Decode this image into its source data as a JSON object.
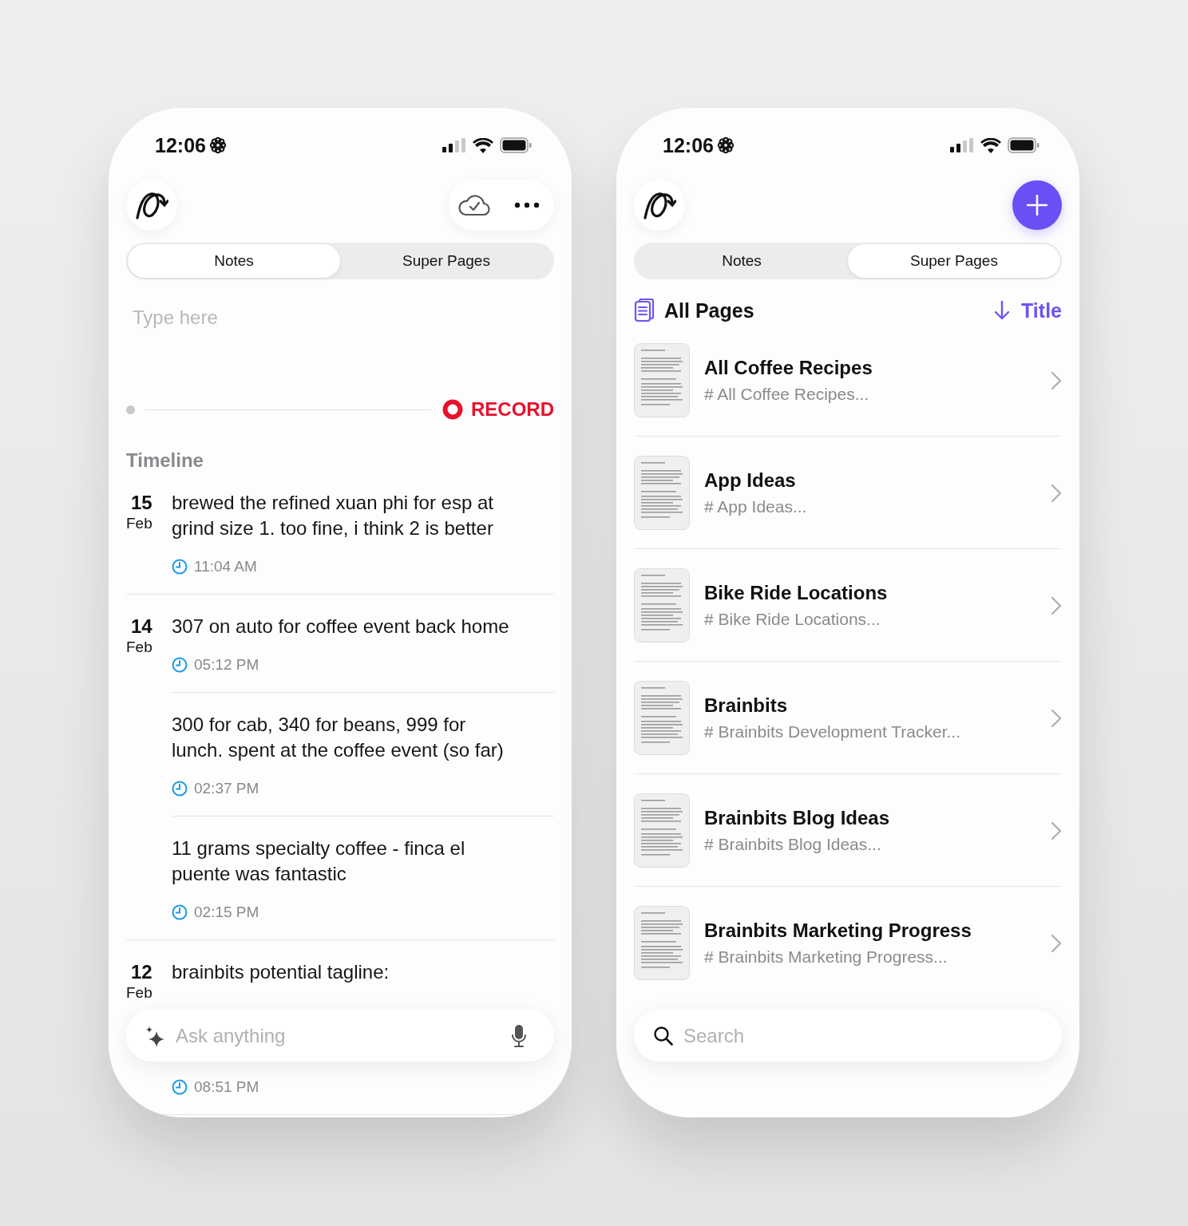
{
  "notes_screen": {
    "status_bar": {
      "time": "12:06"
    },
    "tabs": [
      {
        "label": "Notes",
        "selected": true
      },
      {
        "label": "Super Pages",
        "selected": false
      }
    ],
    "compose": {
      "placeholder": "Type here"
    },
    "record_button": "RECORD",
    "timeline": {
      "title": "Timeline",
      "days": [
        {
          "day": "15",
          "month": "Feb",
          "notes": [
            {
              "text": "brewed the refined xuan phi for esp at grind size 1. too fine, i think 2 is better",
              "time": "11:04 AM"
            }
          ]
        },
        {
          "day": "14",
          "month": "Feb",
          "notes": [
            {
              "text": "307 on auto for coffee event back home",
              "time": "05:12 PM"
            },
            {
              "text": "300 for cab, 340 for beans, 999 for lunch. spent at the coffee event (so far)",
              "time": "02:37 PM"
            },
            {
              "text": "11 grams specialty coffee - finca el puente was fantastic",
              "time": "02:15 PM"
            }
          ]
        },
        {
          "day": "12",
          "month": "Feb",
          "notes": [
            {
              "text": "brainbits potential tagline:",
              "time": "08:51 PM"
            }
          ]
        }
      ]
    },
    "ask_bar": {
      "placeholder": "Ask anything"
    }
  },
  "pages_screen": {
    "status_bar": {
      "time": "12:06"
    },
    "tabs": [
      {
        "label": "Notes",
        "selected": false
      },
      {
        "label": "Super Pages",
        "selected": true
      }
    ],
    "list_header": {
      "title": "All Pages",
      "sort": "Title"
    },
    "pages": [
      {
        "title": "All Coffee Recipes",
        "preview": "# All Coffee Recipes..."
      },
      {
        "title": "App Ideas",
        "preview": "# App Ideas..."
      },
      {
        "title": "Bike Ride Locations",
        "preview": "# Bike Ride Locations..."
      },
      {
        "title": "Brainbits",
        "preview": "# Brainbits Development Tracker..."
      },
      {
        "title": "Brainbits Blog Ideas",
        "preview": "# Brainbits Blog Ideas..."
      },
      {
        "title": "Brainbits Marketing Progress",
        "preview": "# Brainbits Marketing Progress..."
      }
    ],
    "search": {
      "placeholder": "Search"
    }
  }
}
